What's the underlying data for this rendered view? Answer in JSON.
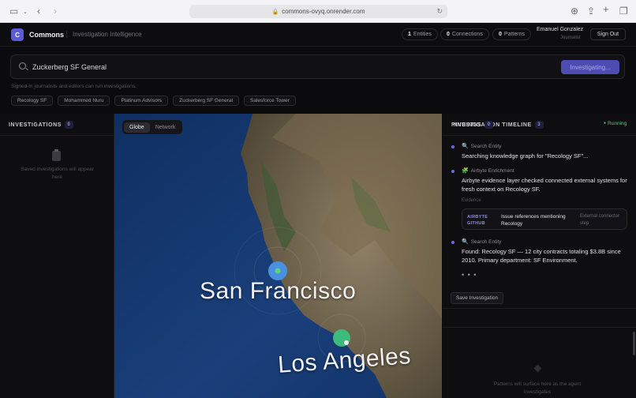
{
  "browser": {
    "url": "commons-ovyq.onrender.com"
  },
  "header": {
    "logo_letter": "C",
    "brand": "Commons",
    "subtitle": "Investigation Intelligence",
    "stats": [
      {
        "value": "1",
        "label": "Entities"
      },
      {
        "value": "0",
        "label": "Connections"
      },
      {
        "value": "0",
        "label": "Patterns"
      }
    ],
    "user_name": "Emanuel Gonzalez",
    "user_role": "Journalist",
    "sign_out": "Sign Out"
  },
  "search": {
    "value": "Zuckerberg SF General",
    "button": "Investigating...",
    "note": "Signed-in journalists and editors can run investigations.",
    "chips": [
      "Recology SF",
      "Mohammed Nuru",
      "Platinum Advisors",
      "Zuckerberg SF General",
      "Salesforce Tower"
    ]
  },
  "investigations": {
    "title": "INVESTIGATIONS",
    "count": "0",
    "empty_text": "Saved investigations will appear here"
  },
  "map": {
    "tabs": [
      "Globe",
      "Network"
    ],
    "active_tab": "Globe",
    "labels": [
      "San Francisco",
      "Los Angeles"
    ],
    "marker_colors": [
      "#4a90e2",
      "#3dbb7a"
    ]
  },
  "timeline": {
    "title": "INVESTIGATION TIMELINE",
    "count": "3",
    "status": "Running",
    "events": [
      {
        "icon": "magnifier",
        "kind": "Search Entity",
        "text": "Searching knowledge graph for \"Recology SF\"..."
      },
      {
        "icon": "puzzle",
        "kind": "Airbyte Enrichment",
        "text": "Airbyte evidence layer checked connected external systems for fresh context on Recology SF."
      },
      {
        "icon": "magnifier",
        "kind": "Search Entity",
        "text": "Found: Recology SF — 12 city contracts totaling $3.8B since 2010. Primary department: SF Environment."
      }
    ],
    "evidence_label": "Evidence",
    "evidence": {
      "source_line1": "AIRBYTE",
      "source_line2": "GITHUB",
      "title": "Issue references mentioning Recology",
      "context": "External connector step"
    },
    "typing": "• • •",
    "save_button": "Save Investigation"
  },
  "findings": {
    "title": "FINDINGS",
    "count": "0",
    "empty_text": "Patterns will surface here as the agent investigates"
  }
}
